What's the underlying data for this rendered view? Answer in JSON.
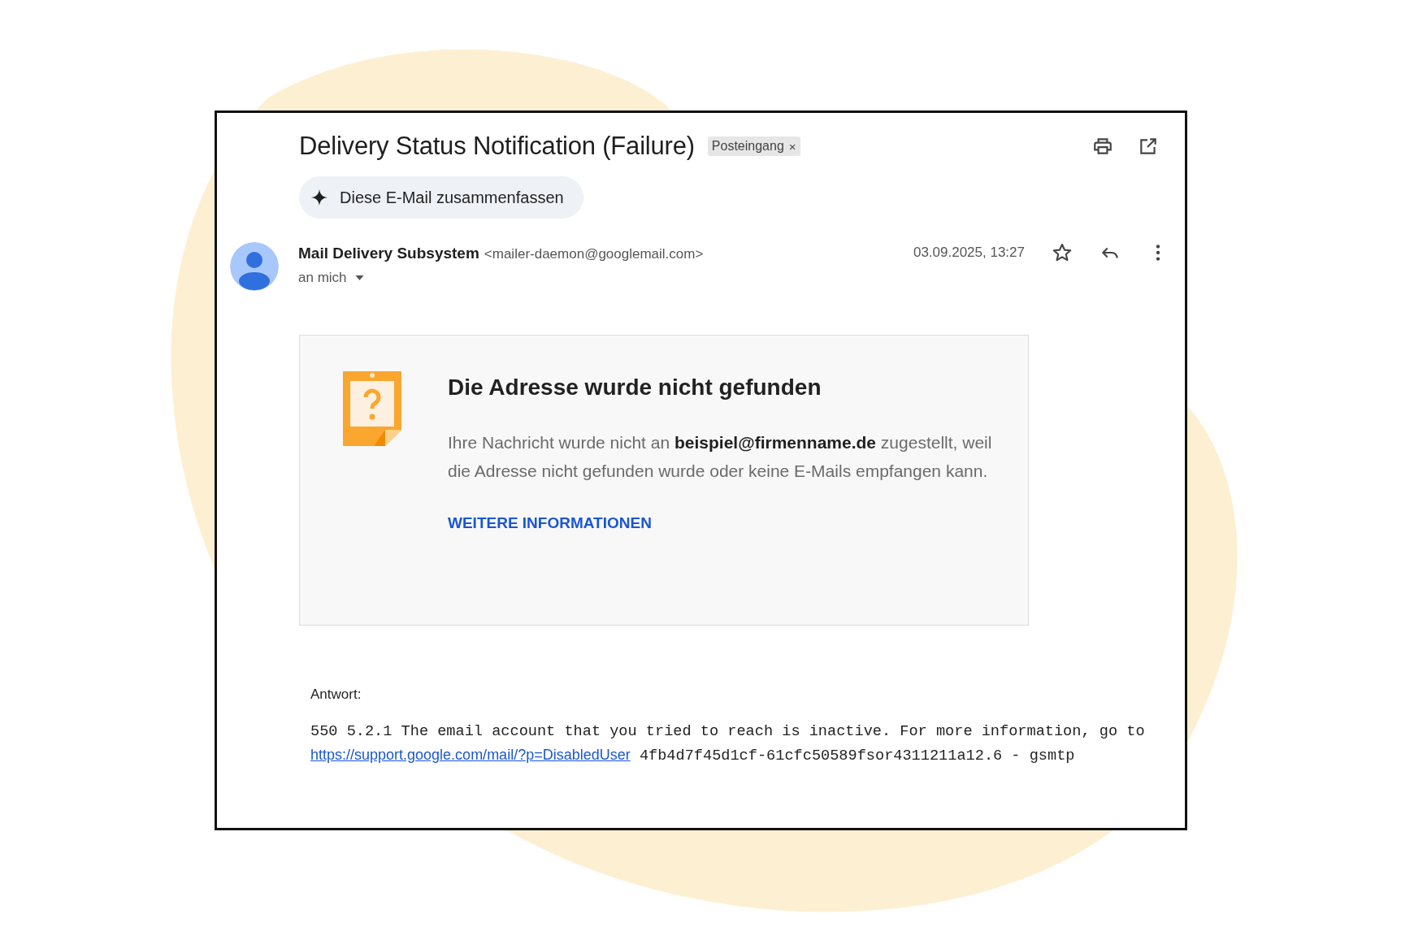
{
  "email": {
    "subject": "Delivery Status Notification (Failure)",
    "label": {
      "text": "Posteingang",
      "remove": "×"
    },
    "summarize_button": "Diese E-Mail zusammenfassen",
    "sender": {
      "name": "Mail Delivery Subsystem",
      "address": "<mailer-daemon@googlemail.com>",
      "recipient": "an mich"
    },
    "date": "03.09.2025, 13:27",
    "starred": false,
    "notice": {
      "heading": "Die Adresse wurde nicht gefunden",
      "message": "Ihre Nachricht wurde nicht an **beispiel@firmenname.de** zugestellt, weil die Adresse nicht gefunden wurde oder keine E-Mails empfangen kann.",
      "link": "WEITERE INFORMATIONEN"
    },
    "response_label": "Antwort:",
    "response": {
      "before": "550 5.2.1 The email account that you tried to reach is inactive. For more information, go to",
      "link": "https://support.google.com/mail/?p=DisabledUser",
      "after": "4fb4d7f45d1cf-61cfc50589fsor4311211a12.6 - gsmtp"
    }
  }
}
